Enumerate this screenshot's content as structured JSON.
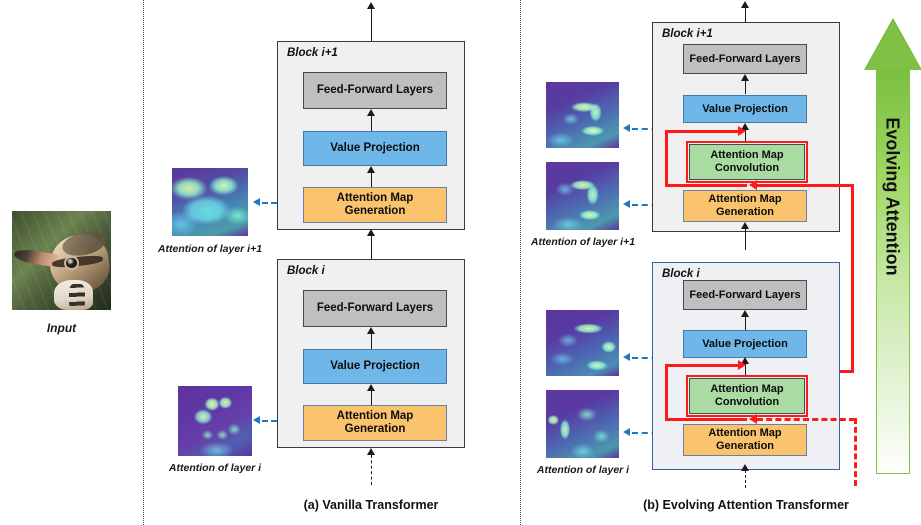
{
  "figure": {
    "input_label": "Input",
    "panels": [
      {
        "id": "a",
        "caption": "(a) Vanilla Transformer"
      },
      {
        "id": "b",
        "caption": "(b) Evolving Attention Transformer"
      }
    ],
    "evolving_arrow": {
      "label": "Evolving Attention",
      "direction": "up",
      "gradient_from": "#ffffff",
      "gradient_to": "#7bbf3e"
    }
  },
  "colors": {
    "feed_forward": "#bfbfbf",
    "value_projection": "#6fb7e8",
    "attention_map_generation": "#fac36d",
    "attention_map_convolution": "#a9dba2",
    "block_background": "#f0f0f0",
    "block_border": "#3a3a3a",
    "blue_block_border": "#3b5f9e",
    "red_path": "#ff1a1a",
    "blue_link": "#2176c7",
    "green_arrow": "#7bbf3e"
  },
  "panel_a": {
    "caption": "(a) Vanilla Transformer",
    "blocks": [
      {
        "label": "Block i+1",
        "modules": [
          {
            "name": "feed-forward-layers",
            "label": "Feed-Forward Layers",
            "color": "#bfbfbf"
          },
          {
            "name": "value-projection",
            "label": "Value Projection",
            "color": "#6fb7e8"
          },
          {
            "name": "attention-map-generation",
            "label": "Attention Map\nGeneration",
            "line1": "Attention Map",
            "line2": "Generation",
            "color": "#fac36d"
          }
        ]
      },
      {
        "label": "Block i",
        "modules": [
          {
            "name": "feed-forward-layers",
            "label": "Feed-Forward Layers",
            "color": "#bfbfbf"
          },
          {
            "name": "value-projection",
            "label": "Value Projection",
            "color": "#6fb7e8"
          },
          {
            "name": "attention-map-generation",
            "label": "Attention Map\nGeneration",
            "line1": "Attention Map",
            "line2": "Generation",
            "color": "#fac36d"
          }
        ]
      }
    ],
    "attention_maps": [
      {
        "caption": "Attention of layer i+1",
        "source_module": "attention-map-generation"
      },
      {
        "caption": "Attention of layer i",
        "source_module": "attention-map-generation"
      }
    ]
  },
  "panel_b": {
    "caption": "(b) Evolving Attention Transformer",
    "blocks": [
      {
        "label": "Block i+1",
        "modules": [
          {
            "name": "feed-forward-layers",
            "label": "Feed-Forward Layers",
            "color": "#bfbfbf"
          },
          {
            "name": "value-projection",
            "label": "Value Projection",
            "color": "#6fb7e8"
          },
          {
            "name": "attention-map-convolution",
            "label": "Attention Map\nConvolution",
            "line1": "Attention Map",
            "line2": "Convolution",
            "color": "#a9dba2",
            "highlighted": true
          },
          {
            "name": "attention-map-generation",
            "label": "Attention Map\nGeneration",
            "line1": "Attention Map",
            "line2": "Generation",
            "color": "#fac36d"
          }
        ]
      },
      {
        "label": "Block i",
        "modules": [
          {
            "name": "feed-forward-layers",
            "label": "Feed-Forward Layers",
            "color": "#bfbfbf"
          },
          {
            "name": "value-projection",
            "label": "Value Projection",
            "color": "#6fb7e8"
          },
          {
            "name": "attention-map-convolution",
            "label": "Attention Map\nConvolution",
            "line1": "Attention Map",
            "line2": "Convolution",
            "color": "#a9dba2",
            "highlighted": true
          },
          {
            "name": "attention-map-generation",
            "label": "Attention Map\nGeneration",
            "line1": "Attention Map",
            "line2": "Generation",
            "color": "#fac36d"
          }
        ]
      }
    ],
    "attention_maps": [
      {
        "caption": "Attention of layer i+1",
        "count": 2
      },
      {
        "caption": "Attention of layer i",
        "count": 2
      }
    ]
  },
  "labels": {
    "block_i": "Block i",
    "block_i_plus_1": "Block i+1",
    "feed_forward_layers": "Feed-Forward Layers",
    "value_projection": "Value Projection",
    "attention_map_line1": "Attention Map",
    "attention_generation_line2": "Generation",
    "attention_convolution_line2": "Convolution",
    "attention_of_layer_i": "Attention of layer i",
    "attention_of_layer_i_plus_1": "Attention of layer i+1"
  }
}
